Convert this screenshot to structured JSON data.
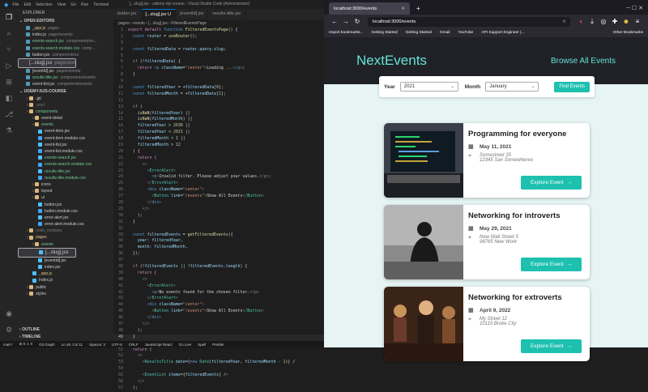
{
  "vscode": {
    "menu": [
      "File",
      "Edit",
      "Selection",
      "View",
      "Go",
      "Run",
      "Terminal"
    ],
    "window_title": "[...slug].jsx - udemy-njs-course - Visual Studio Code [Administrator]",
    "explorer_title": "EXPLORER",
    "open_editors_label": "OPEN EDITORS",
    "project_label": "UDEMY-NJS-COURSE",
    "open_editors": [
      {
        "name": "_app.js",
        "path": "pages",
        "cls": "mod"
      },
      {
        "name": "index.js",
        "path": "pages\\events",
        "cls": ""
      },
      {
        "name": "events-search.jsx",
        "path": "components\\ev...",
        "cls": "new"
      },
      {
        "name": "events-search.module.css",
        "path": "comp...",
        "cls": "new"
      },
      {
        "name": "button.jsx",
        "path": "components\\ui",
        "cls": ""
      },
      {
        "name": "[...slug].jsx",
        "path": "pages\\events",
        "cls": "sel"
      },
      {
        "name": "[eventId].jsx",
        "path": "pages\\events",
        "cls": ""
      },
      {
        "name": "results-title.jsx",
        "path": "components\\events",
        "cls": "new"
      },
      {
        "name": "event-list.jsx",
        "path": "components\\events",
        "cls": ""
      }
    ],
    "tree": [
      {
        "name": ".git",
        "d": 1,
        "folder": true,
        "cls": ""
      },
      {
        "name": ".next",
        "d": 1,
        "folder": true,
        "cls": "dimf"
      },
      {
        "name": "components",
        "d": 1,
        "folder": true,
        "cls": "new"
      },
      {
        "name": "event-detail",
        "d": 2,
        "folder": true,
        "cls": ""
      },
      {
        "name": "events",
        "d": 2,
        "folder": true,
        "cls": "new"
      },
      {
        "name": "event-item.jsx",
        "d": 3,
        "folder": false,
        "cls": ""
      },
      {
        "name": "event-item.module.css",
        "d": 3,
        "folder": false,
        "cls": ""
      },
      {
        "name": "event-list.jsx",
        "d": 3,
        "folder": false,
        "cls": ""
      },
      {
        "name": "event-list.module.css",
        "d": 3,
        "folder": false,
        "cls": ""
      },
      {
        "name": "events-search.jsx",
        "d": 3,
        "folder": false,
        "cls": "new"
      },
      {
        "name": "events-search.module.css",
        "d": 3,
        "folder": false,
        "cls": "new"
      },
      {
        "name": "results-title.jsx",
        "d": 3,
        "folder": false,
        "cls": "new"
      },
      {
        "name": "results-title.module.css",
        "d": 3,
        "folder": false,
        "cls": "new"
      },
      {
        "name": "icons",
        "d": 2,
        "folder": true,
        "cls": ""
      },
      {
        "name": "layout",
        "d": 2,
        "folder": true,
        "cls": ""
      },
      {
        "name": "ui",
        "d": 2,
        "folder": true,
        "cls": ""
      },
      {
        "name": "button.jsx",
        "d": 3,
        "folder": false,
        "cls": ""
      },
      {
        "name": "button.module.css",
        "d": 3,
        "folder": false,
        "cls": ""
      },
      {
        "name": "error-alert.jsx",
        "d": 3,
        "folder": false,
        "cls": ""
      },
      {
        "name": "error-alert.module.css",
        "d": 3,
        "folder": false,
        "cls": ""
      },
      {
        "name": "node_modules",
        "d": 1,
        "folder": true,
        "cls": "dimf"
      },
      {
        "name": "pages",
        "d": 1,
        "folder": true,
        "cls": "mod"
      },
      {
        "name": "events",
        "d": 2,
        "folder": true,
        "cls": "new"
      },
      {
        "name": "[...slug].jsx",
        "d": 3,
        "folder": false,
        "cls": "sel"
      },
      {
        "name": "[eventId].jsx",
        "d": 3,
        "folder": false,
        "cls": ""
      },
      {
        "name": "index.jsx",
        "d": 3,
        "folder": false,
        "cls": ""
      },
      {
        "name": "_app.js",
        "d": 2,
        "folder": false,
        "cls": "mod"
      },
      {
        "name": "index.js",
        "d": 2,
        "folder": false,
        "cls": ""
      },
      {
        "name": "public",
        "d": 1,
        "folder": true,
        "cls": ""
      },
      {
        "name": "styles",
        "d": 1,
        "folder": true,
        "cls": ""
      }
    ],
    "outline_label": "OUTLINE",
    "timeline_label": "TIMELINE",
    "tabs": [
      {
        "label": "button.jsx",
        "active": false
      },
      {
        "label": "[...slug].jsx U",
        "active": true
      },
      {
        "label": "[eventId].jsx",
        "active": false
      },
      {
        "label": "results-title.jsx",
        "active": false
      }
    ],
    "breadcrumb": "pages › events › [...slug].jsx › FilteredEventsPage",
    "status": [
      "main*",
      "⊗ 0 ⚠ 0",
      "Git Graph",
      "Ln 49, Col 11",
      "Spaces: 2",
      "UTF-8",
      "CRLF",
      "JavaScript React",
      "Go Live",
      "Spell",
      "Prettier"
    ]
  },
  "code_lines": [
    {
      "n": "1",
      "h": "<span class=\"kw\">export default</span> <span class=\"kb\">function</span> <span class=\"fn\">FilteredEventsPage</span>() {"
    },
    {
      "n": "2",
      "h": "  <span class=\"kb\">const</span> <span class=\"vr\">router</span> = <span class=\"fn\">useRouter</span>();"
    },
    {
      "n": "3",
      "h": ""
    },
    {
      "n": "4",
      "h": "  <span class=\"kb\">const</span> <span class=\"vr\">filteredData</span> = <span class=\"vr\">router</span>.<span class=\"vr\">query</span>.<span class=\"vr\">slug</span>;"
    },
    {
      "n": "5",
      "h": ""
    },
    {
      "n": "6",
      "h": "  <span class=\"kw\">if</span> (!<span class=\"vr\">filteredData</span>) {"
    },
    {
      "n": "7",
      "h": "    <span class=\"kw\">return</span> <span class=\"pn\">&lt;</span><span class=\"kb\">p</span> <span class=\"at\">className</span>=<span class=\"st\">\"center\"</span><span class=\"pn\">&gt;</span>Loading ...<span class=\"pn\">&lt;/</span><span class=\"kb\">p</span><span class=\"pn\">&gt;</span>;"
    },
    {
      "n": "8",
      "h": "  }"
    },
    {
      "n": "9",
      "h": ""
    },
    {
      "n": "10",
      "h": "  <span class=\"kb\">const</span> <span class=\"vr\">filteredYear</span> = +<span class=\"vr\">filteredData</span>[<span class=\"nm\">0</span>];"
    },
    {
      "n": "11",
      "h": "  <span class=\"kb\">const</span> <span class=\"vr\">filteredMonth</span> = +<span class=\"vr\">filteredData</span>[<span class=\"nm\">1</span>];"
    },
    {
      "n": "12",
      "h": ""
    },
    {
      "n": "13",
      "h": "  <span class=\"kw\">if</span> ("
    },
    {
      "n": "14",
      "h": "    <span class=\"fn\">isNaN</span>(<span class=\"vr\">filteredYear</span>) ||"
    },
    {
      "n": "15",
      "h": "    <span class=\"fn\">isNaN</span>(<span class=\"vr\">filteredMonth</span>) ||"
    },
    {
      "n": "16",
      "h": "    <span class=\"vr\">filteredYear</span> &gt; <span class=\"nm\">2030</span> ||"
    },
    {
      "n": "17",
      "h": "    <span class=\"vr\">filteredYear</span> &lt; <span class=\"nm\">2021</span> ||"
    },
    {
      "n": "18",
      "h": "    <span class=\"vr\">filteredMonth</span> &lt; <span class=\"nm\">1</span> ||"
    },
    {
      "n": "19",
      "h": "    <span class=\"vr\">filteredMonth</span> &gt; <span class=\"nm\">12</span>"
    },
    {
      "n": "20",
      "h": "  ) {"
    },
    {
      "n": "21",
      "h": "    <span class=\"kw\">return</span> ("
    },
    {
      "n": "22",
      "h": "      <span class=\"pn\">&lt;&gt;</span>"
    },
    {
      "n": "23",
      "h": "        <span class=\"pn\">&lt;</span><span class=\"tg\">ErrorAlert</span><span class=\"pn\">&gt;</span>"
    },
    {
      "n": "24",
      "h": "          <span class=\"pn\">&lt;</span><span class=\"kb\">p</span><span class=\"pn\">&gt;</span>Invalid filter. Please adjust your values.<span class=\"pn\">&lt;/</span><span class=\"kb\">p</span><span class=\"pn\">&gt;</span>;"
    },
    {
      "n": "25",
      "h": "        <span class=\"pn\">&lt;/</span><span class=\"tg\">ErrorAlert</span><span class=\"pn\">&gt;</span>"
    },
    {
      "n": "26",
      "h": "        <span class=\"pn\">&lt;</span><span class=\"kb\">div</span> <span class=\"at\">className</span>=<span class=\"st\">\"center\"</span><span class=\"pn\">&gt;</span>"
    },
    {
      "n": "27",
      "h": "          <span class=\"pn\">&lt;</span><span class=\"tg\">Button</span> <span class=\"at\">link</span>=<span class=\"st\">\"/events\"</span><span class=\"pn\">&gt;</span>Show All Events<span class=\"pn\">&lt;/</span><span class=\"tg\">Button</span><span class=\"pn\">&gt;</span>"
    },
    {
      "n": "28",
      "h": "        <span class=\"pn\">&lt;/</span><span class=\"kb\">div</span><span class=\"pn\">&gt;</span>"
    },
    {
      "n": "29",
      "h": "      <span class=\"pn\">&lt;/&gt;</span>"
    },
    {
      "n": "30",
      "h": "    );"
    },
    {
      "n": "31",
      "h": "  }"
    },
    {
      "n": "32",
      "h": ""
    },
    {
      "n": "33",
      "h": "  <span class=\"kb\">const</span> <span class=\"vr\">filteredEvents</span> = <span class=\"fn\">getFilteredEvents</span>({"
    },
    {
      "n": "34",
      "h": "    <span class=\"vr\">year</span>: <span class=\"vr\">filteredYear</span>,"
    },
    {
      "n": "35",
      "h": "    <span class=\"vr\">month</span>: <span class=\"vr\">filteredMonth</span>,"
    },
    {
      "n": "36",
      "h": "  });"
    },
    {
      "n": "37",
      "h": ""
    },
    {
      "n": "38",
      "h": "  <span class=\"kw\">if</span> (!<span class=\"vr\">filteredEvents</span> || !<span class=\"vr\">filteredEvents</span>.<span class=\"vr\">length</span>) {"
    },
    {
      "n": "39",
      "h": "    <span class=\"kw\">return</span> ("
    },
    {
      "n": "40",
      "h": "      <span class=\"pn\">&lt;&gt;</span>"
    },
    {
      "n": "41",
      "h": "        <span class=\"pn\">&lt;</span><span class=\"tg\">ErrorAlert</span><span class=\"pn\">&gt;</span>"
    },
    {
      "n": "42",
      "h": "          <span class=\"pn\">&lt;</span><span class=\"kb\">p</span><span class=\"pn\">&gt;</span>No events found for the chosen filter.<span class=\"pn\">&lt;/</span><span class=\"kb\">p</span><span class=\"pn\">&gt;</span>"
    },
    {
      "n": "43",
      "h": "        <span class=\"pn\">&lt;/</span><span class=\"tg\">ErrorAlert</span><span class=\"pn\">&gt;</span>"
    },
    {
      "n": "44",
      "h": "        <span class=\"pn\">&lt;</span><span class=\"kb\">div</span> <span class=\"at\">className</span>=<span class=\"st\">\"center\"</span><span class=\"pn\">&gt;</span>"
    },
    {
      "n": "45",
      "h": "          <span class=\"pn\">&lt;</span><span class=\"tg\">Button</span> <span class=\"at\">link</span>=<span class=\"st\">\"/events\"</span><span class=\"pn\">&gt;</span>Show All Events<span class=\"pn\">&lt;/</span><span class=\"tg\">Button</span><span class=\"pn\">&gt;</span>"
    },
    {
      "n": "46",
      "h": "        <span class=\"pn\">&lt;/</span><span class=\"kb\">div</span><span class=\"pn\">&gt;</span>"
    },
    {
      "n": "47",
      "h": "      <span class=\"pn\">&lt;/&gt;</span>"
    },
    {
      "n": "48",
      "h": "    );"
    },
    {
      "n": "49",
      "h": "  }"
    },
    {
      "n": "50",
      "h": ""
    },
    {
      "n": "51",
      "h": "  <span class=\"kw\">return</span> ("
    },
    {
      "n": "52",
      "h": "    <span class=\"pn\">&lt;&gt;</span>"
    },
    {
      "n": "53",
      "h": "      <span class=\"pn\">&lt;</span><span class=\"tg\">ResultsTitle</span> <span class=\"at\">date</span>={<span class=\"kb\">new</span> <span class=\"tg\">Date</span>(<span class=\"vr\">filteredYear</span>, <span class=\"vr\">filteredMonth</span> - <span class=\"nm\">1</span>)} /"
    },
    {
      "n": "54",
      "h": ""
    },
    {
      "n": "55",
      "h": "      <span class=\"pn\">&lt;</span><span class=\"tg\">EventList</span> <span class=\"at\">items</span>={<span class=\"vr\">filteredEvents</span>} /<span class=\"pn\">&gt;</span>"
    },
    {
      "n": "56",
      "h": "    <span class=\"pn\">&lt;/&gt;</span>"
    },
    {
      "n": "57",
      "h": "  );"
    }
  ],
  "firefox": {
    "tab_title": "localhost:3000/events",
    "url": "localhost:3000/events",
    "bookmarks": [
      "Import bookmarks...",
      "Getting Started",
      "Getting Started",
      "Gmail",
      "YouTube",
      "API Support Engineer (..."
    ],
    "other_bookmarks": "Other Bookmarks"
  },
  "site": {
    "logo": "NextEvents",
    "nav_link": "Browse All Events",
    "filter": {
      "year_label": "Year",
      "year_value": "2021",
      "month_label": "Month",
      "month_value": "January",
      "button": "Find Events"
    },
    "events": [
      {
        "title": "Programming for everyone",
        "date": "May 11, 2021",
        "street": "Somestreet 25",
        "city": "12345 San Somewhereo",
        "cta": "Explore Event",
        "img": "laptop"
      },
      {
        "title": "Networking for introverts",
        "date": "May 29, 2021",
        "street": "New Wall Street 5",
        "city": "98765 New Work",
        "cta": "Explore Event",
        "img": "silhouette"
      },
      {
        "title": "Networking for extroverts",
        "date": "April 9, 2022",
        "street": "My Street 12",
        "city": "10115 Broke City",
        "cta": "Explore Event",
        "img": "crowd"
      }
    ]
  },
  "colors": {
    "accent": "#1ec0b0",
    "logo": "#64e4d8",
    "header_bg": "#1f2126",
    "page_bg": "#e6f4f3"
  }
}
